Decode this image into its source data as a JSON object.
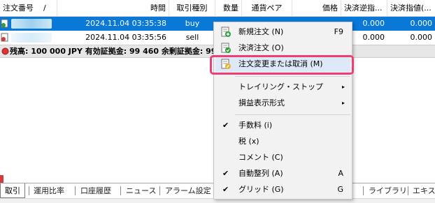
{
  "table": {
    "headers": [
      {
        "key": "order_no",
        "label": "注文番号",
        "sort": "/"
      },
      {
        "key": "time",
        "label": "時間"
      },
      {
        "key": "type",
        "label": "取引種別"
      },
      {
        "key": "qty",
        "label": "数量"
      },
      {
        "key": "pair",
        "label": "通貨ペア"
      },
      {
        "key": "price",
        "label": "価格"
      },
      {
        "key": "sl",
        "label": "決済逆指..."
      },
      {
        "key": "tp",
        "label": "決済指値(..."
      }
    ],
    "rows": [
      {
        "time": "2024.11.04 03:35:38",
        "type": "buy",
        "qty": "",
        "pair": "",
        "price": "",
        "sl": "0.000",
        "tp": "0.000"
      },
      {
        "time": "2024.11.04 03:35:56",
        "type": "sell",
        "qty": "",
        "pair": "",
        "price": "",
        "sl": "0.000",
        "tp": "0.000"
      }
    ]
  },
  "balance_text": "残高: 100 000 JPY 有効証拠金: 99 460 余剰証拠金: 99",
  "context_menu": {
    "items": [
      {
        "label": "新規注文 (N)",
        "accel": "F9"
      },
      {
        "label": "決済注文 (O)",
        "accel": ""
      },
      {
        "label": "注文変更または取消 (M)",
        "accel": ""
      },
      {
        "label": "トレイリング・ストップ",
        "submenu": true
      },
      {
        "label": "損益表示形式",
        "submenu": true
      },
      {
        "label": "手数料 (i)",
        "checked": true
      },
      {
        "label": "税 (x)",
        "checked": false
      },
      {
        "label": "コメント (C)",
        "checked": false
      },
      {
        "label": "自動整列 (A)",
        "checked": true,
        "accel": "A"
      },
      {
        "label": "グリッド (G)",
        "checked": true,
        "accel": "G"
      }
    ],
    "submenu_arrow": "▸",
    "check_mark": "✔"
  },
  "tabs": [
    {
      "label": "取引",
      "active": true
    },
    {
      "label": "運用比率"
    },
    {
      "label": "口座履歴"
    },
    {
      "label": "ニュース"
    },
    {
      "label": "アラーム設定"
    },
    {
      "label": "ライブラリ"
    },
    {
      "label": "エキスパ"
    }
  ],
  "colors": {
    "selection": "#0a78d7",
    "highlight_box": "#ee3f74",
    "menu_bg": "#f2f2f2"
  }
}
